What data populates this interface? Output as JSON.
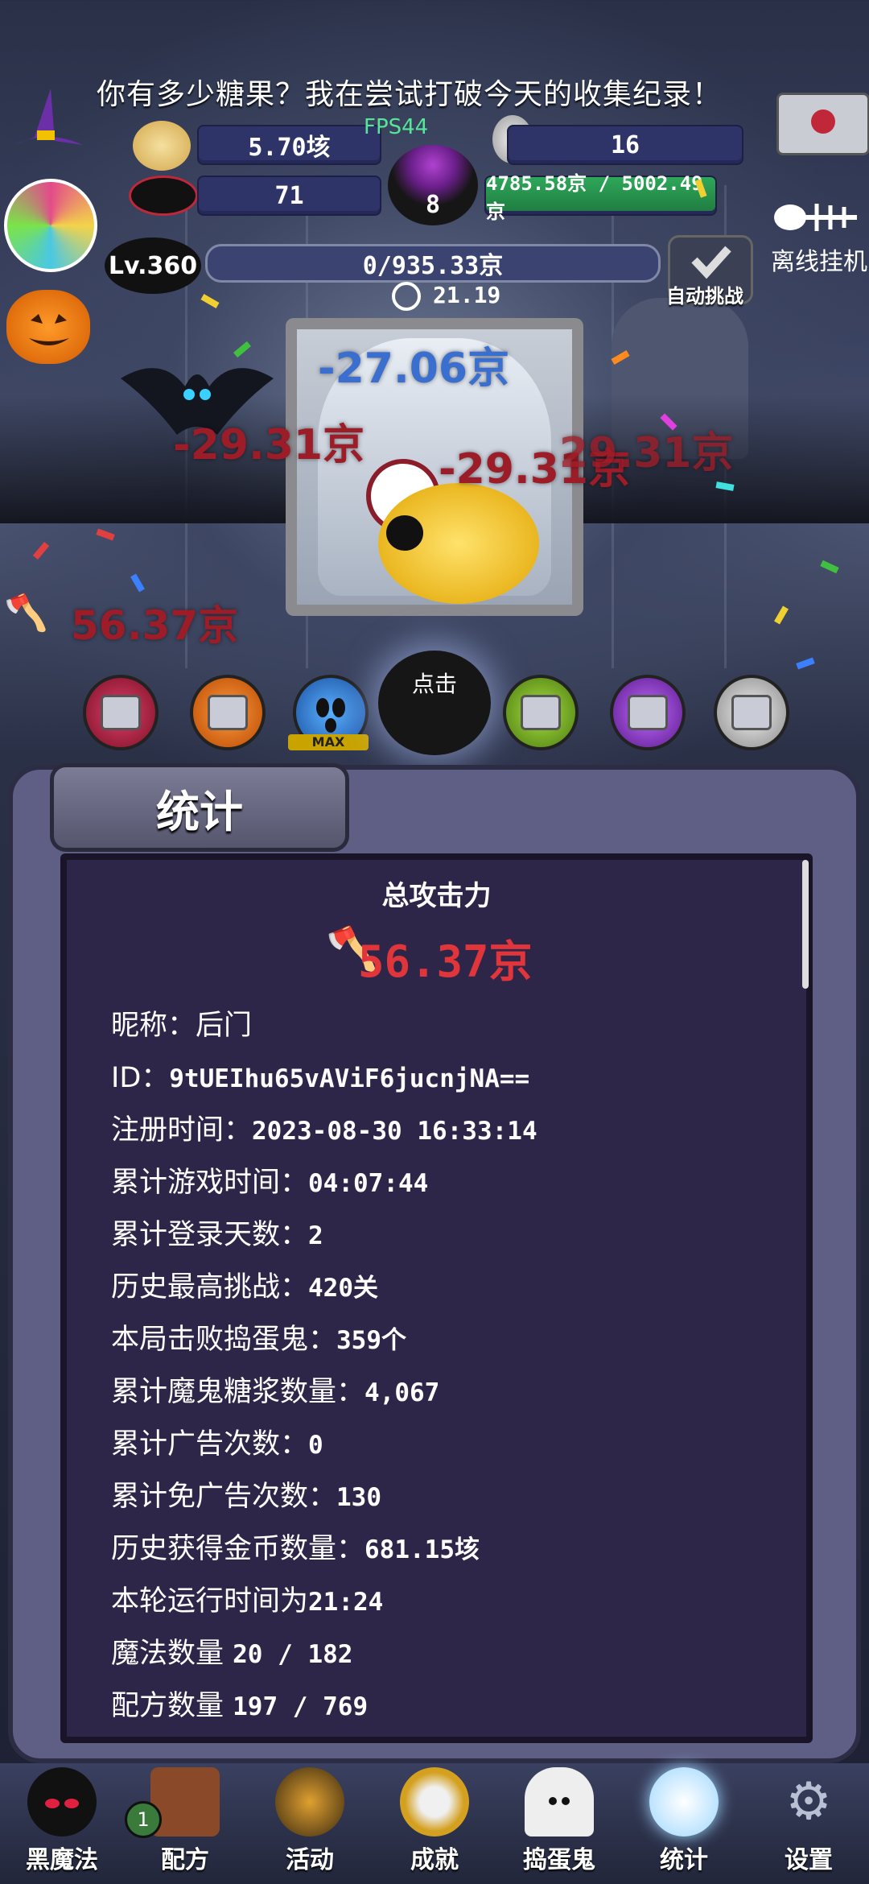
{
  "header": {
    "banner": "你有多少糖果？我在尝试打破今天的收集纪录！",
    "fps": "FPS44",
    "candy_total": "5.70垓",
    "skull_count": "16",
    "ribbon_count": "71",
    "cauldron_count": "8",
    "hp_progress": "4785.58京 / 5002.49京",
    "level": "Lv.360",
    "xp_progress": "0/935.33京",
    "timer": "21.19",
    "auto_challenge_label": "自动挑战",
    "offline_label": "离线挂机",
    "colors": {
      "pill": "#2f3468",
      "green": "#2ea85a",
      "accent_red": "#e0353a"
    }
  },
  "battle": {
    "damage_texts": [
      "-27.06京",
      "-29.31京",
      "-29.31京",
      "29.31京",
      "56.37京"
    ],
    "skills": [
      {
        "name": "red-skill",
        "locked": true,
        "color": "#b8233f"
      },
      {
        "name": "orange-skill",
        "locked": true,
        "color": "#e0641c"
      },
      {
        "name": "blue-skill",
        "locked": false,
        "color": "#2a7ad6",
        "tag": "MAX"
      },
      {
        "name": "click-boss",
        "label": "点击"
      },
      {
        "name": "green-skill",
        "locked": true,
        "color": "#6aa81e"
      },
      {
        "name": "purple-skill",
        "locked": true,
        "color": "#8b2fb8"
      },
      {
        "name": "white-skill",
        "locked": true,
        "color": "#c8c8c8"
      }
    ],
    "max_tag": "MAX",
    "click_label": "点击"
  },
  "stats_panel": {
    "tab_title": "统计",
    "heading": "总攻击力",
    "total_attack": "56.37京",
    "rows": [
      {
        "label": "昵称：",
        "value": "后门"
      },
      {
        "label": "ID：",
        "value": "9tUEIhu65vAViF6jucnjNA=="
      },
      {
        "label": "注册时间：",
        "value": "2023-08-30 16:33:14"
      },
      {
        "label": "累计游戏时间：",
        "value": "04:07:44"
      },
      {
        "label": "累计登录天数：",
        "value": "2"
      },
      {
        "label": "历史最高挑战：",
        "value": "420关"
      },
      {
        "label": "本局击败捣蛋鬼：",
        "value": "359个"
      },
      {
        "label": "累计魔鬼糖浆数量：",
        "value": "4,067"
      },
      {
        "label": "累计广告次数：",
        "value": "0"
      },
      {
        "label": "累计免广告次数：",
        "value": "130"
      },
      {
        "label": "历史获得金币数量：",
        "value": "681.15垓"
      },
      {
        "label": "本轮运行时间为",
        "value": "21:24"
      },
      {
        "label": "魔法数量 ",
        "value": "20 / 182"
      },
      {
        "label": "配方数量 ",
        "value": "197 / 769"
      }
    ]
  },
  "nav": {
    "items": [
      {
        "label": "黑魔法",
        "icon": "devil-icon"
      },
      {
        "label": "配方",
        "icon": "book-icon",
        "badge": "1"
      },
      {
        "label": "活动",
        "icon": "cauldron-icon"
      },
      {
        "label": "成就",
        "icon": "trophy-icon"
      },
      {
        "label": "捣蛋鬼",
        "icon": "ghost-icon"
      },
      {
        "label": "统计",
        "icon": "crystal-ball-icon"
      },
      {
        "label": "设置",
        "icon": "gear-icon"
      }
    ]
  }
}
